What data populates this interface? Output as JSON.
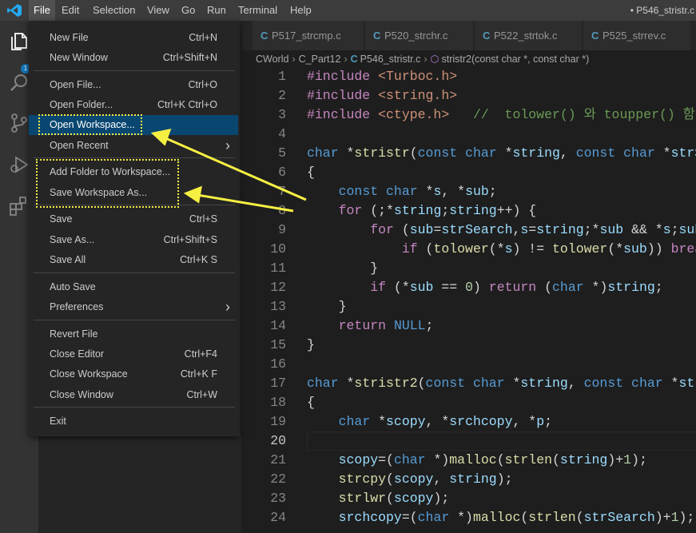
{
  "menubar": {
    "items": [
      "File",
      "Edit",
      "Selection",
      "View",
      "Go",
      "Run",
      "Terminal",
      "Help"
    ],
    "active": "File",
    "window_title": "• P546_stristr.c"
  },
  "activity_bar": {
    "icons": [
      "explorer-icon",
      "search-icon",
      "source-control-icon",
      "run-debug-icon",
      "extensions-icon"
    ],
    "explorer_badge": "1"
  },
  "tabs": [
    {
      "label": "P517_strcmp.c",
      "icon": "C"
    },
    {
      "label": "P520_strchr.c",
      "icon": "C"
    },
    {
      "label": "P522_strtok.c",
      "icon": "C"
    },
    {
      "label": "P525_strrev.c",
      "icon": "C"
    }
  ],
  "breadcrumb": {
    "items": [
      "CWorld",
      "C_Part12",
      "P546_stristr.c",
      "stristr2(const char *, const char *)"
    ]
  },
  "file_menu": {
    "groups": [
      [
        {
          "label": "New File",
          "key": "Ctrl+N"
        },
        {
          "label": "New Window",
          "key": "Ctrl+Shift+N"
        }
      ],
      [
        {
          "label": "Open File...",
          "key": "Ctrl+O"
        },
        {
          "label": "Open Folder...",
          "key": "Ctrl+K Ctrl+O"
        },
        {
          "label": "Open Workspace...",
          "key": ""
        },
        {
          "label": "Open Recent",
          "key": "",
          "submenu": true
        }
      ],
      [
        {
          "label": "Add Folder to Workspace...",
          "key": ""
        },
        {
          "label": "Save Workspace As...",
          "key": ""
        }
      ],
      [
        {
          "label": "Save",
          "key": "Ctrl+S"
        },
        {
          "label": "Save As...",
          "key": "Ctrl+Shift+S"
        },
        {
          "label": "Save All",
          "key": "Ctrl+K S"
        }
      ],
      [
        {
          "label": "Auto Save",
          "key": ""
        },
        {
          "label": "Preferences",
          "key": "",
          "submenu": true
        }
      ],
      [
        {
          "label": "Revert File",
          "key": ""
        },
        {
          "label": "Close Editor",
          "key": "Ctrl+F4"
        },
        {
          "label": "Close Workspace",
          "key": "Ctrl+K F"
        },
        {
          "label": "Close Window",
          "key": "Ctrl+W"
        }
      ],
      [
        {
          "label": "Exit",
          "key": ""
        }
      ]
    ],
    "selected": "Open Workspace..."
  },
  "colors": {
    "keyword": "#569cd6",
    "control": "#c586c0",
    "type": "#569cd6",
    "string": "#ce9178",
    "comment": "#6a9955",
    "function": "#dcdcaa",
    "variable": "#9cdcfe",
    "number": "#b5cea8",
    "text": "#d4d4d4",
    "annotation": "#f5ef42"
  },
  "editor": {
    "current_line": 20,
    "lines": [
      {
        "n": "1",
        "tokens": [
          [
            "#include ",
            "control"
          ],
          [
            "<Turboc.h>",
            "string"
          ]
        ]
      },
      {
        "n": "2",
        "tokens": [
          [
            "#include ",
            "control"
          ],
          [
            "<string.h>",
            "string"
          ]
        ]
      },
      {
        "n": "3",
        "tokens": [
          [
            "#include ",
            "control"
          ],
          [
            "<ctype.h>",
            "string"
          ],
          [
            "   //  tolower() 와 toupper() 함",
            "comment"
          ]
        ]
      },
      {
        "n": "4",
        "tokens": []
      },
      {
        "n": "5",
        "tokens": [
          [
            "char",
            "type"
          ],
          [
            " *",
            "text"
          ],
          [
            "stristr",
            "function"
          ],
          [
            "(",
            "text"
          ],
          [
            "const",
            "type"
          ],
          [
            " ",
            "text"
          ],
          [
            "char",
            "type"
          ],
          [
            " *",
            "text"
          ],
          [
            "string",
            "variable"
          ],
          [
            ", ",
            "text"
          ],
          [
            "const",
            "type"
          ],
          [
            " ",
            "text"
          ],
          [
            "char",
            "type"
          ],
          [
            " *",
            "text"
          ],
          [
            "strS",
            "variable"
          ]
        ]
      },
      {
        "n": "6",
        "tokens": [
          [
            "{",
            "text"
          ]
        ]
      },
      {
        "n": "7",
        "tokens": [
          [
            "    ",
            "text"
          ],
          [
            "const",
            "type"
          ],
          [
            " ",
            "text"
          ],
          [
            "char",
            "type"
          ],
          [
            " *",
            "text"
          ],
          [
            "s",
            "variable"
          ],
          [
            ", *",
            "text"
          ],
          [
            "sub",
            "variable"
          ],
          [
            ";",
            "text"
          ]
        ]
      },
      {
        "n": "8",
        "tokens": [
          [
            "    ",
            "text"
          ],
          [
            "for",
            "control"
          ],
          [
            " (;*",
            "text"
          ],
          [
            "string",
            "variable"
          ],
          [
            ";",
            "text"
          ],
          [
            "string",
            "variable"
          ],
          [
            "++) {",
            "text"
          ]
        ]
      },
      {
        "n": "9",
        "tokens": [
          [
            "        ",
            "text"
          ],
          [
            "for",
            "control"
          ],
          [
            " (",
            "text"
          ],
          [
            "sub",
            "variable"
          ],
          [
            "=",
            "text"
          ],
          [
            "strSearch",
            "variable"
          ],
          [
            ",",
            "text"
          ],
          [
            "s",
            "variable"
          ],
          [
            "=",
            "text"
          ],
          [
            "string",
            "variable"
          ],
          [
            ";*",
            "text"
          ],
          [
            "sub",
            "variable"
          ],
          [
            " && *",
            "text"
          ],
          [
            "s",
            "variable"
          ],
          [
            ";",
            "text"
          ],
          [
            "sub",
            "variable"
          ]
        ]
      },
      {
        "n": "10",
        "tokens": [
          [
            "            ",
            "text"
          ],
          [
            "if",
            "control"
          ],
          [
            " (",
            "text"
          ],
          [
            "tolower",
            "function"
          ],
          [
            "(*",
            "text"
          ],
          [
            "s",
            "variable"
          ],
          [
            ") != ",
            "text"
          ],
          [
            "tolower",
            "function"
          ],
          [
            "(*",
            "text"
          ],
          [
            "sub",
            "variable"
          ],
          [
            ")) ",
            "text"
          ],
          [
            "brea",
            "control"
          ]
        ]
      },
      {
        "n": "11",
        "tokens": [
          [
            "        }",
            "text"
          ]
        ]
      },
      {
        "n": "12",
        "tokens": [
          [
            "        ",
            "text"
          ],
          [
            "if",
            "control"
          ],
          [
            " (*",
            "text"
          ],
          [
            "sub",
            "variable"
          ],
          [
            " == ",
            "text"
          ],
          [
            "0",
            "number"
          ],
          [
            ") ",
            "text"
          ],
          [
            "return",
            "control"
          ],
          [
            " (",
            "text"
          ],
          [
            "char",
            "type"
          ],
          [
            " *)",
            "text"
          ],
          [
            "string",
            "variable"
          ],
          [
            ";",
            "text"
          ]
        ]
      },
      {
        "n": "13",
        "tokens": [
          [
            "    }",
            "text"
          ]
        ]
      },
      {
        "n": "14",
        "tokens": [
          [
            "    ",
            "text"
          ],
          [
            "return",
            "control"
          ],
          [
            " ",
            "text"
          ],
          [
            "NULL",
            "keyword"
          ],
          [
            ";",
            "text"
          ]
        ]
      },
      {
        "n": "15",
        "tokens": [
          [
            "}",
            "text"
          ]
        ]
      },
      {
        "n": "16",
        "tokens": []
      },
      {
        "n": "17",
        "tokens": [
          [
            "char",
            "type"
          ],
          [
            " *",
            "text"
          ],
          [
            "stristr2",
            "function"
          ],
          [
            "(",
            "text"
          ],
          [
            "const",
            "type"
          ],
          [
            " ",
            "text"
          ],
          [
            "char",
            "type"
          ],
          [
            " *",
            "text"
          ],
          [
            "string",
            "variable"
          ],
          [
            ", ",
            "text"
          ],
          [
            "const",
            "type"
          ],
          [
            " ",
            "text"
          ],
          [
            "char",
            "type"
          ],
          [
            " *",
            "text"
          ],
          [
            "str",
            "variable"
          ]
        ]
      },
      {
        "n": "18",
        "tokens": [
          [
            "{",
            "text"
          ]
        ]
      },
      {
        "n": "19",
        "tokens": [
          [
            "    ",
            "text"
          ],
          [
            "char",
            "type"
          ],
          [
            " *",
            "text"
          ],
          [
            "scopy",
            "variable"
          ],
          [
            ", *",
            "text"
          ],
          [
            "srchcopy",
            "variable"
          ],
          [
            ", *",
            "text"
          ],
          [
            "p",
            "variable"
          ],
          [
            ";",
            "text"
          ]
        ]
      },
      {
        "n": "20",
        "tokens": []
      },
      {
        "n": "21",
        "tokens": [
          [
            "    ",
            "text"
          ],
          [
            "scopy",
            "variable"
          ],
          [
            "=(",
            "text"
          ],
          [
            "char",
            "type"
          ],
          [
            " *)",
            "text"
          ],
          [
            "malloc",
            "function"
          ],
          [
            "(",
            "text"
          ],
          [
            "strlen",
            "function"
          ],
          [
            "(",
            "text"
          ],
          [
            "string",
            "variable"
          ],
          [
            ")+",
            "text"
          ],
          [
            "1",
            "number"
          ],
          [
            ");",
            "text"
          ]
        ]
      },
      {
        "n": "22",
        "tokens": [
          [
            "    ",
            "text"
          ],
          [
            "strcpy",
            "function"
          ],
          [
            "(",
            "text"
          ],
          [
            "scopy",
            "variable"
          ],
          [
            ", ",
            "text"
          ],
          [
            "string",
            "variable"
          ],
          [
            ");",
            "text"
          ]
        ]
      },
      {
        "n": "23",
        "tokens": [
          [
            "    ",
            "text"
          ],
          [
            "strlwr",
            "function"
          ],
          [
            "(",
            "text"
          ],
          [
            "scopy",
            "variable"
          ],
          [
            ");",
            "text"
          ]
        ]
      },
      {
        "n": "24",
        "tokens": [
          [
            "    ",
            "text"
          ],
          [
            "srchcopy",
            "variable"
          ],
          [
            "=(",
            "text"
          ],
          [
            "char",
            "type"
          ],
          [
            " *)",
            "text"
          ],
          [
            "malloc",
            "function"
          ],
          [
            "(",
            "text"
          ],
          [
            "strlen",
            "function"
          ],
          [
            "(",
            "text"
          ],
          [
            "strSearch",
            "variable"
          ],
          [
            ")+",
            "text"
          ],
          [
            "1",
            "number"
          ],
          [
            ");",
            "text"
          ]
        ]
      }
    ]
  }
}
